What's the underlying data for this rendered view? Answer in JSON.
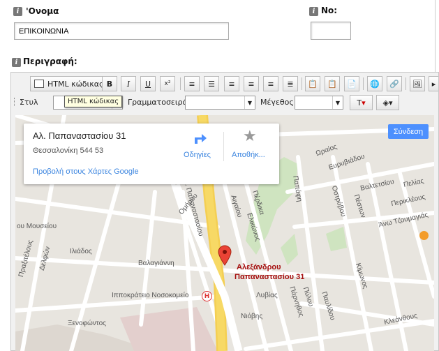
{
  "form": {
    "name_label": "'Ονομα",
    "name_value": "ΕΠΙΚΟΙΝΩΝΙΑ",
    "no_label": "Νο:",
    "no_value": "",
    "description_label": "Περιγραφή:",
    "info_glyph": "i"
  },
  "toolbar": {
    "html_label": "HTML κώδικας",
    "bold": "B",
    "italic": "I",
    "underline": "U",
    "superscript": "x²",
    "style_label": "Στυλ",
    "font_label": "Γραμματοσειρά",
    "size_label": "Μέγεθος",
    "tooltip": "HTML κώδικας"
  },
  "map": {
    "address": "Αλ. Παπαναστασίου 31",
    "city": "Θεσσαλονίκη 544 53",
    "directions": "Οδηγίες",
    "save": "Αποθήκ...",
    "view_link": "Προβολή στους Χάρτες Google",
    "signin": "Σύνδεση",
    "marker_label_1": "Αλεξάνδρου",
    "marker_label_2": "Παπαναστασίου 31",
    "hospital_marker": "H",
    "streets": {
      "oraios": "Ωραίος",
      "evryviadou": "Ευρυβιάδου",
      "valtetsiou": "Βαλτετσίου",
      "pelias": "Πελίας",
      "perikleous": "Περικλέους",
      "peston": "Πέστων",
      "anotz": "Άνω Τζουμαγιάς",
      "ostrovou": "Οστρόβου",
      "pordika": "Πέρδικα",
      "aigaiou": "Αιγαίου",
      "elikonos": "Ελικώνος",
      "papafi": "Παπάφη",
      "papanastasiou": "Αλ. Παπαναστασίου",
      "omirou": "Ομήρου",
      "mouseiou": "ου Μουσείου",
      "praxitelous": "Πραξιτέλους",
      "delfon": "Δελφών",
      "iliados": "Ιλιάδος",
      "valagianni": "Βαλαγιάννη",
      "hospital": "Ιπποκράτειο Νοσοκομείο",
      "kimonos": "Κίμωνος",
      "lyvias": "Λυβίας",
      "parnithos": "Πάρνηθος",
      "pylou": "Πύλου",
      "pavlidou": "Παυλίδου",
      "niovis": "Νιόβης",
      "kleanthous": "Κλεάνθους",
      "xenofontos": "Ξενοφώντος"
    }
  }
}
